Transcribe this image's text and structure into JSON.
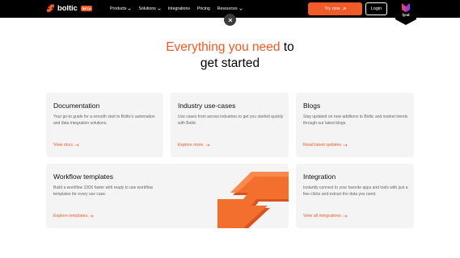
{
  "brand": {
    "name": "boltic",
    "beta_label": "BETA",
    "accent": "#f15a29"
  },
  "nav": {
    "items": [
      {
        "label": "Products",
        "dropdown": true
      },
      {
        "label": "Solutions",
        "dropdown": true
      },
      {
        "label": "Integrations",
        "dropdown": false
      },
      {
        "label": "Pricing",
        "dropdown": false
      },
      {
        "label": "Resources",
        "dropdown": true
      }
    ]
  },
  "header": {
    "try_label": "Try now",
    "login_label": "Login",
    "fynd_label": "fynd"
  },
  "hero": {
    "title_accent": "Everything you need",
    "title_rest_1": " to",
    "title_rest_2": "get started"
  },
  "cards": {
    "documentation": {
      "title": "Documentation",
      "desc": "Your go-to guide for a smooth start to Boltic's automation and data integration solutions.",
      "link": "View docs"
    },
    "industry": {
      "title": "Industry use-cases",
      "desc": "Use cases from across industries to get you started quickly with Boltic",
      "link": "Explore more"
    },
    "blogs": {
      "title": "Blogs",
      "desc": "Stay updated on new additions to Boltic and market trends through our latest blogs.",
      "link": "Read latest updates"
    },
    "workflow": {
      "title": "Workflow templates",
      "desc": "Build a workflow 100X faster with ready to use workflow templates for every use case.",
      "link": "Explore templates"
    },
    "integration": {
      "title": "Integration",
      "desc": "Instantly connect to your favorite apps and tools with just a few clicks and extract the data you need.",
      "link": "View all integrations"
    }
  }
}
